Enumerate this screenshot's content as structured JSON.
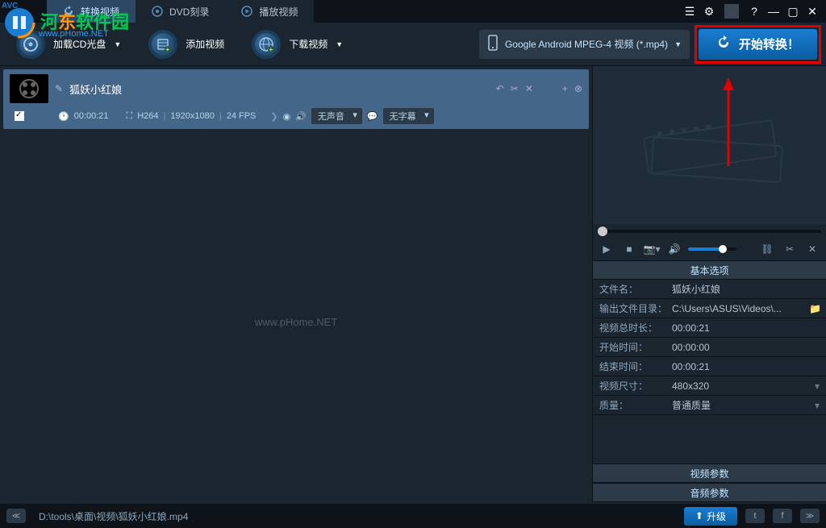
{
  "tabs": {
    "convert": "转换视频",
    "dvd": "DVD刻录",
    "play": "播放视频"
  },
  "toolbar": {
    "load_cd": "加载CD光盘",
    "add_video": "添加视频",
    "download": "下载视频",
    "format": "Google Android MPEG-4 视频 (*.mp4)",
    "convert": "开始转换！"
  },
  "file": {
    "title": "狐妖小红娘",
    "duration": "00:00:21",
    "codec": "H264",
    "res": "1920x1080",
    "fps": "24 FPS",
    "audio_label": "无声音",
    "subtitle_label": "无字幕"
  },
  "watermark": "www.pHome.NET",
  "props": {
    "basicHeader": "基本选项",
    "filename_l": "文件名：",
    "filename_v": "狐妖小红娘",
    "outdir_l": "输出文件目录：",
    "outdir_v": "C:\\Users\\ASUS\\Videos\\...",
    "total_l": "视频总时长：",
    "total_v": "00:00:21",
    "start_l": "开始时间：",
    "start_v": "00:00:00",
    "end_l": "结束时间：",
    "end_v": "00:00:21",
    "size_l": "视频尺寸：",
    "size_v": "480x320",
    "quality_l": "质量：",
    "quality_v": "普通质量",
    "videoParams": "视频参数",
    "audioParams": "音频参数"
  },
  "statusbar": {
    "path": "D:\\tools\\桌面\\视频\\狐妖小红娘.mp4",
    "upgrade": "升级"
  },
  "logo": {
    "text_a": "河",
    "text_b": "东",
    "text_c": "软件园",
    "sub": "www.pHome.NET"
  },
  "avc": "AVC"
}
